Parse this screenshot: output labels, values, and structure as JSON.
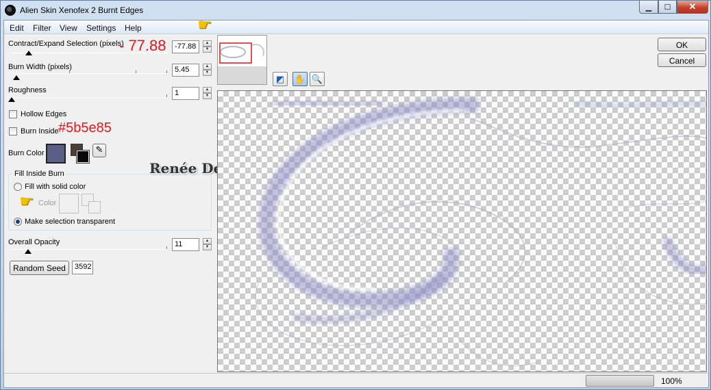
{
  "window": {
    "title": "Alien Skin Xenofex 2 Burnt Edges"
  },
  "menu": {
    "items": [
      "Edit",
      "Filter",
      "View",
      "Settings",
      "Help"
    ]
  },
  "controls": {
    "contract_label": "Contract/Expand Selection (pixels)",
    "contract_value": "-77.88",
    "burn_width_label": "Burn Width (pixels)",
    "burn_width_value": "5.45",
    "roughness_label": "Roughness",
    "roughness_value": "1",
    "hollow_edges_label": "Hollow Edges",
    "burn_inside_label": "Burn Inside",
    "burn_color_label": "Burn Color",
    "burn_color": "#5b5e85",
    "fill_group_title": "Fill Inside Burn",
    "fill_solid_label": "Fill with solid color",
    "color_label": "Color",
    "make_transparent_label": "Make selection transparent",
    "opacity_label": "Overall Opacity",
    "opacity_value": "11",
    "random_seed_label": "Random Seed",
    "random_seed_value": "3592"
  },
  "annotations": {
    "contract_note": "- 77.88",
    "color_note": "#5b5e85",
    "watermark": "Renée Design"
  },
  "buttons": {
    "ok": "OK",
    "cancel": "Cancel"
  },
  "status": {
    "zoom": "100%"
  }
}
